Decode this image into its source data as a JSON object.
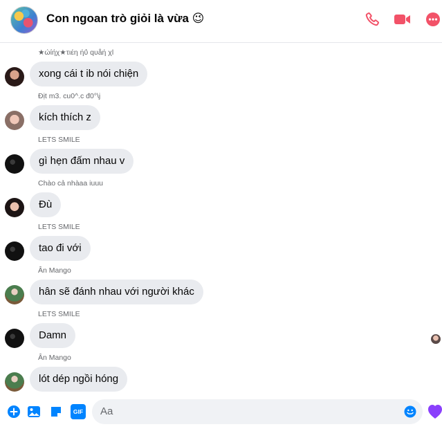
{
  "header": {
    "title": "Con ngoan trò giỏi là vừa 😉",
    "accent_color": "#f25268"
  },
  "messages": [
    {
      "sender": "★ώίήχ★τιέη ήΰ qυåή χl",
      "text": "xong cái t ib nói chiện",
      "avatar": "girl-portrait-1"
    },
    {
      "sender": "Địt m3. cu0^.c đ0°\\j",
      "text": "kích thích z",
      "avatar": "girl-portrait-2"
    },
    {
      "sender": "LETS SMILE",
      "text": "gì hẹn đấm nhau v",
      "avatar": "dark-avatar"
    },
    {
      "sender": "Chào cả nhàaa iuuu",
      "text": "Đù",
      "avatar": "girl-portrait-3"
    },
    {
      "sender": "LETS SMILE",
      "text": "tao đi với",
      "avatar": "dark-avatar"
    },
    {
      "sender": "Ân Mango",
      "text": "hân sẽ đánh nhau với người khác",
      "avatar": "mango-avatar"
    },
    {
      "sender": "LETS SMILE",
      "text": "Damn",
      "avatar": "dark-avatar"
    },
    {
      "sender": "Ân Mango",
      "text": "lót dép ngồi hóng",
      "avatar": "mango-avatar"
    }
  ],
  "composer": {
    "placeholder": "Aa",
    "gif_label": "GIF",
    "accent_color": "#0084ff"
  }
}
